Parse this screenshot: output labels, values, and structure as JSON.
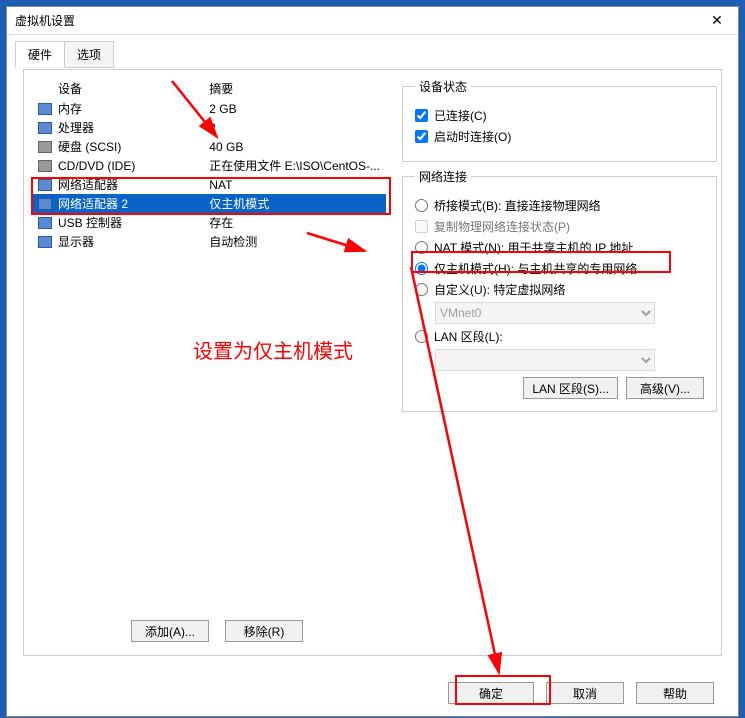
{
  "title": "虚拟机设置",
  "tabs": {
    "hardware": "硬件",
    "options": "选项"
  },
  "columns": {
    "device": "设备",
    "summary": "摘要"
  },
  "devices": [
    {
      "name": "内存",
      "summary": "2 GB",
      "icon": "mem"
    },
    {
      "name": "处理器",
      "summary": "2",
      "icon": "cpu"
    },
    {
      "name": "硬盘 (SCSI)",
      "summary": "40 GB",
      "icon": "hdd"
    },
    {
      "name": "CD/DVD (IDE)",
      "summary": "正在使用文件 E:\\ISO\\CentOS-...",
      "icon": "cd"
    },
    {
      "name": "网络适配器",
      "summary": "NAT",
      "icon": "net"
    },
    {
      "name": "网络适配器 2",
      "summary": "仅主机模式",
      "icon": "net",
      "selected": true
    },
    {
      "name": "USB 控制器",
      "summary": "存在",
      "icon": "usb"
    },
    {
      "name": "显示器",
      "summary": "自动检测",
      "icon": "disp"
    }
  ],
  "buttons": {
    "add": "添加(A)...",
    "remove": "移除(R)",
    "lan": "LAN 区段(S)...",
    "advanced": "高级(V)...",
    "ok": "确定",
    "cancel": "取消",
    "help": "帮助"
  },
  "status": {
    "legend": "设备状态",
    "connected": "已连接(C)",
    "connect_on": "启动时连接(O)"
  },
  "net": {
    "legend": "网络连接",
    "bridge": "桥接模式(B): 直接连接物理网络",
    "replicate": "复制物理网络连接状态(P)",
    "nat": "NAT 模式(N): 用于共享主机的 IP 地址",
    "host": "仅主机模式(H): 与主机共享的专用网络",
    "custom": "自定义(U): 特定虚拟网络",
    "vmnet": "VMnet0",
    "lan": "LAN 区段(L):"
  },
  "annotation": "设置为仅主机模式"
}
